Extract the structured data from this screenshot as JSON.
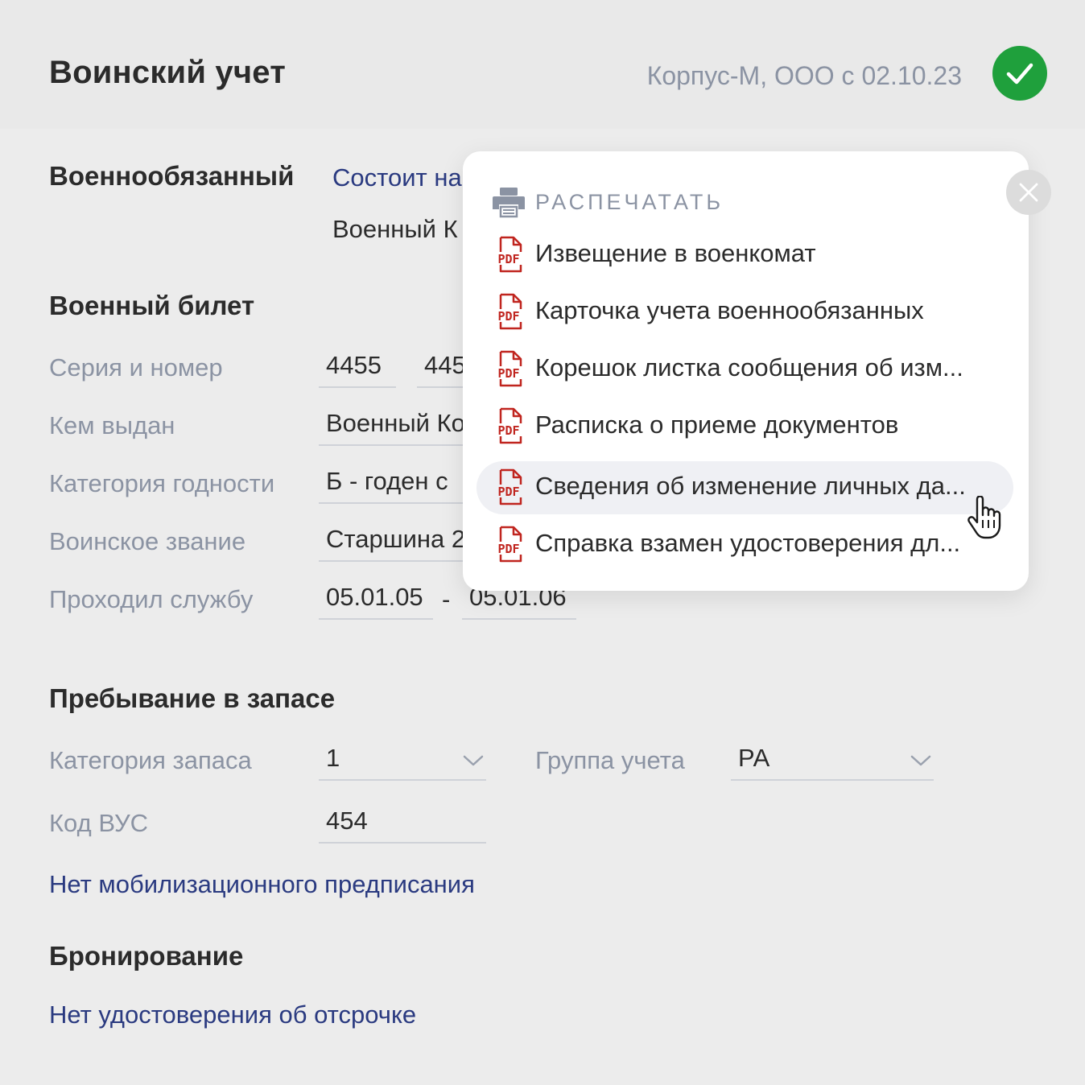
{
  "header": {
    "title": "Воинский учет",
    "company": "Корпус-М, ООО с 02.10.23",
    "status_icon": "check-icon",
    "accent_color": "#1fa03c"
  },
  "conscript": {
    "heading": "Военнообязанный",
    "status_link": "Состоит на",
    "office": "Военный К"
  },
  "military_id": {
    "heading": "Военный билет",
    "rows": [
      {
        "label": "Серия и номер",
        "series": "4455",
        "number": "445"
      },
      {
        "label": "Кем выдан",
        "value": "Военный Ко"
      },
      {
        "label": "Категория годности",
        "value": "Б - годен с"
      },
      {
        "label": "Воинское звание",
        "value": "Старшина 2"
      },
      {
        "label": "Проходил службу",
        "from": "05.01.05",
        "separator": "-",
        "to": "05.01.06"
      }
    ]
  },
  "reserve": {
    "heading": "Пребывание в запасе",
    "category_label": "Категория запаса",
    "category_value": "1",
    "group_label": "Группа учета",
    "group_value": "РА",
    "vus_label": "Код ВУС",
    "vus_value": "454",
    "mobilization_link": "Нет мобилизационного предписания"
  },
  "booking": {
    "heading": "Бронирование",
    "deferral_link": "Нет удостоверения об отсрочке"
  },
  "print_menu": {
    "heading": "РАСПЕЧАТАТЬ",
    "heading_icon": "printer-icon",
    "item_icon": "pdf-icon",
    "pdf_color": "#c0251f",
    "hovered_index": 4,
    "items": [
      {
        "label": "Извещение в военкомат"
      },
      {
        "label": "Карточка учета военнообязанных"
      },
      {
        "label": "Корешок листка сообщения об изм..."
      },
      {
        "label": "Расписка о приеме документов"
      },
      {
        "label": "Сведения об изменение личных да..."
      },
      {
        "label": "Справка взамен удостоверения дл..."
      }
    ],
    "close_icon": "close-icon"
  }
}
